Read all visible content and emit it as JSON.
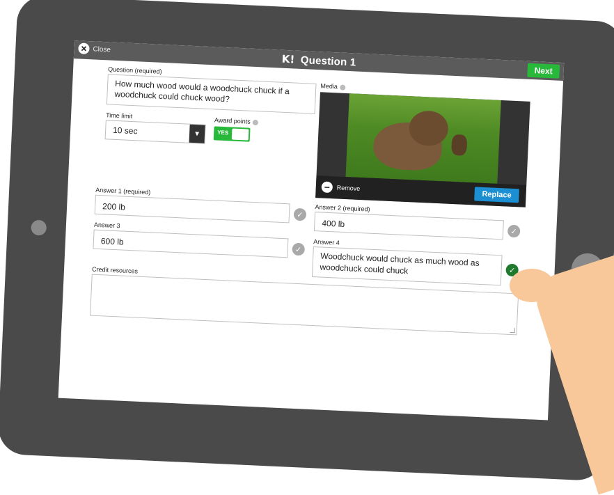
{
  "topbar": {
    "close_label": "Close",
    "title_logo": "K!",
    "title": "Question 1",
    "next_label": "Next"
  },
  "question": {
    "label": "Question (required)",
    "value": "How much wood would a woodchuck chuck if a woodchuck could chuck wood?"
  },
  "time_limit": {
    "label": "Time limit",
    "value": "10 sec"
  },
  "award_points": {
    "label": "Award points",
    "toggle_value": "YES"
  },
  "media": {
    "label": "Media",
    "remove_label": "Remove",
    "replace_label": "Replace"
  },
  "answers": [
    {
      "label": "Answer 1 (required)",
      "value": "200 lb",
      "correct": false
    },
    {
      "label": "Answer 2 (required)",
      "value": "400 lb",
      "correct": false
    },
    {
      "label": "Answer 3",
      "value": "600 lb",
      "correct": false
    },
    {
      "label": "Answer 4",
      "value": "Woodchuck would chuck as much wood as woodchuck could chuck",
      "correct": true
    }
  ],
  "credit": {
    "label": "Credit resources",
    "value": ""
  },
  "colors": {
    "topbar": "#5b5b5b",
    "next_green": "#29b93a",
    "replace_blue": "#1b8fd1",
    "correct_green": "#1f7a2d",
    "tablet": "#4a4a4a",
    "hand": "#f9c89a"
  }
}
